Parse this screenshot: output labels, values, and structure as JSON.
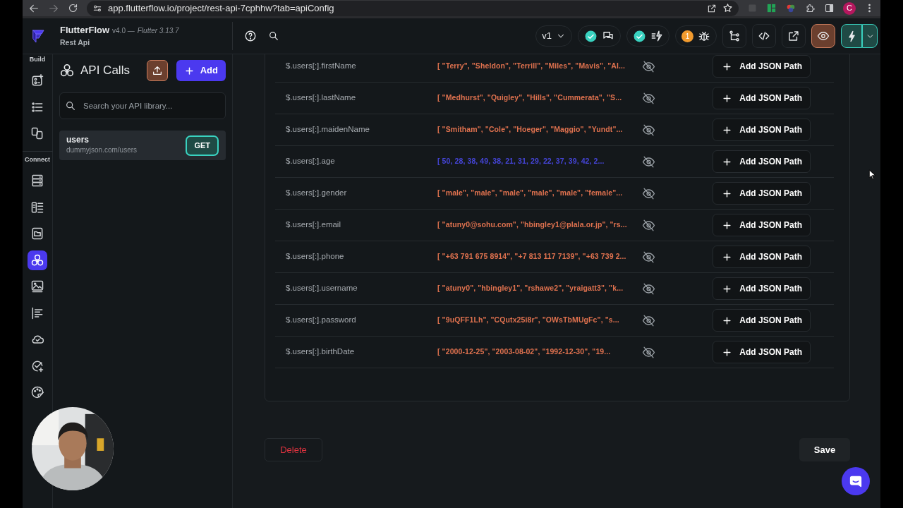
{
  "browser": {
    "url": "app.flutterflow.io/project/rest-api-7cphhw?tab=apiConfig",
    "profile": "C"
  },
  "app": {
    "name": "FlutterFlow",
    "version": "v4.0 —",
    "flutter": "Flutter 3.13.7",
    "project": "Rest Api"
  },
  "toolbar": {
    "version": "v1",
    "issues": "1"
  },
  "rail": [
    {
      "label": "Build",
      "items": [
        {
          "selected": false
        },
        {
          "selected": false
        },
        {
          "selected": false
        }
      ]
    },
    {
      "label": "Connect",
      "items": [
        {
          "selected": false
        },
        {
          "selected": false
        },
        {
          "selected": false
        },
        {
          "selected": true
        },
        {
          "selected": false
        },
        {
          "selected": false
        },
        {
          "selected": false
        },
        {
          "selected": false
        },
        {
          "selected": false
        }
      ]
    }
  ],
  "panel": {
    "title": "API Calls",
    "add": "Add",
    "search": {
      "placeholder": "Search your API library..."
    },
    "calls": [
      {
        "name": "users",
        "url": "dummyjson.com/users",
        "method": "GET",
        "selected": true
      }
    ]
  },
  "paths": [
    {
      "path": "$.users[:].firstName",
      "value": "[ \"Terry\", \"Sheldon\", \"Terrill\", \"Miles\", \"Mavis\", \"Al...",
      "kind": "string",
      "button": "Add JSON Path"
    },
    {
      "path": "$.users[:].lastName",
      "value": "[ \"Medhurst\", \"Quigley\", \"Hills\", \"Cummerata\", \"S...",
      "kind": "string",
      "button": "Add JSON Path"
    },
    {
      "path": "$.users[:].maidenName",
      "value": "[ \"Smitham\", \"Cole\", \"Hoeger\", \"Maggio\", \"Yundt\"...",
      "kind": "string",
      "button": "Add JSON Path"
    },
    {
      "path": "$.users[:].age",
      "value": "[ 50, 28, 38, 49, 38, 21, 31, 29, 22, 37, 39, 42, 2...",
      "kind": "number",
      "button": "Add JSON Path"
    },
    {
      "path": "$.users[:].gender",
      "value": "[ \"male\", \"male\", \"male\", \"male\", \"male\", \"female\"...",
      "kind": "string",
      "button": "Add JSON Path"
    },
    {
      "path": "$.users[:].email",
      "value": "[ \"atuny0@sohu.com\", \"hbingley1@plala.or.jp\", \"rs...",
      "kind": "string",
      "button": "Add JSON Path"
    },
    {
      "path": "$.users[:].phone",
      "value": "[ \"+63 791 675 8914\", \"+7 813 117 7139\", \"+63 739 2...",
      "kind": "string",
      "button": "Add JSON Path"
    },
    {
      "path": "$.users[:].username",
      "value": "[ \"atuny0\", \"hbingley1\", \"rshawe2\", \"yraigatt3\", \"k...",
      "kind": "string",
      "button": "Add JSON Path"
    },
    {
      "path": "$.users[:].password",
      "value": "[ \"9uQFF1Lh\", \"CQutx25i8r\", \"OWsTbMUgFc\", \"s...",
      "kind": "string",
      "button": "Add JSON Path"
    },
    {
      "path": "$.users[:].birthDate",
      "value": "[ \"2000-12-25\", \"2003-08-02\", \"1992-12-30\", \"19...",
      "kind": "string",
      "button": "Add JSON Path"
    }
  ],
  "footer": {
    "delete": "Delete",
    "save": "Save"
  }
}
